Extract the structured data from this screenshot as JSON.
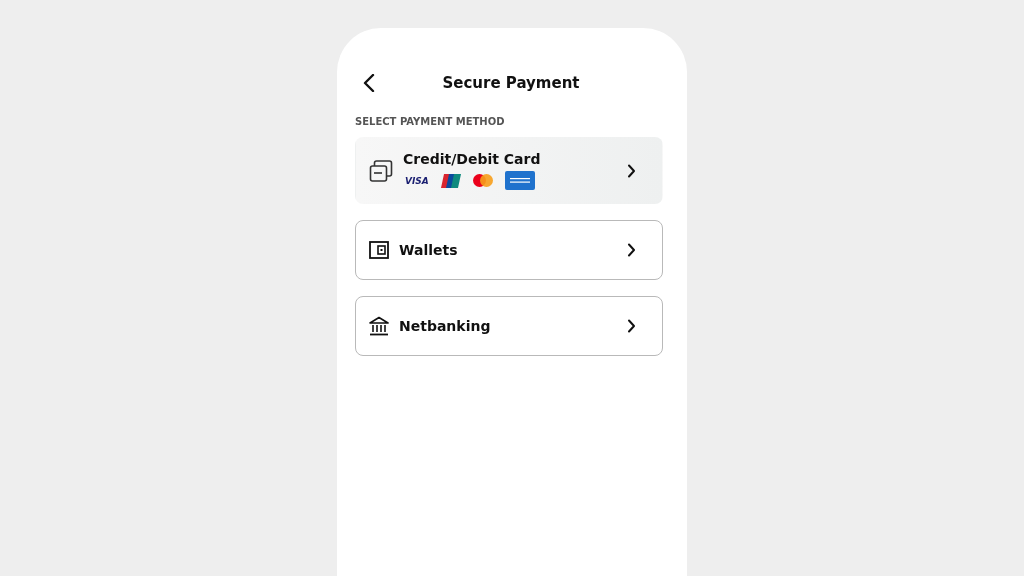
{
  "header": {
    "title": "Secure Payment"
  },
  "section_label": "SELECT PAYMENT METHOD",
  "methods": [
    {
      "kind": "card",
      "label": "Credit/Debit Card",
      "selected": true,
      "logos": [
        {
          "kind": "visa",
          "label": "VISA"
        },
        {
          "kind": "unionpay"
        },
        {
          "kind": "mastercard"
        },
        {
          "kind": "amex"
        }
      ]
    },
    {
      "kind": "wallet",
      "label": "Wallets",
      "selected": false
    },
    {
      "kind": "bank",
      "label": "Netbanking",
      "selected": false
    }
  ]
}
